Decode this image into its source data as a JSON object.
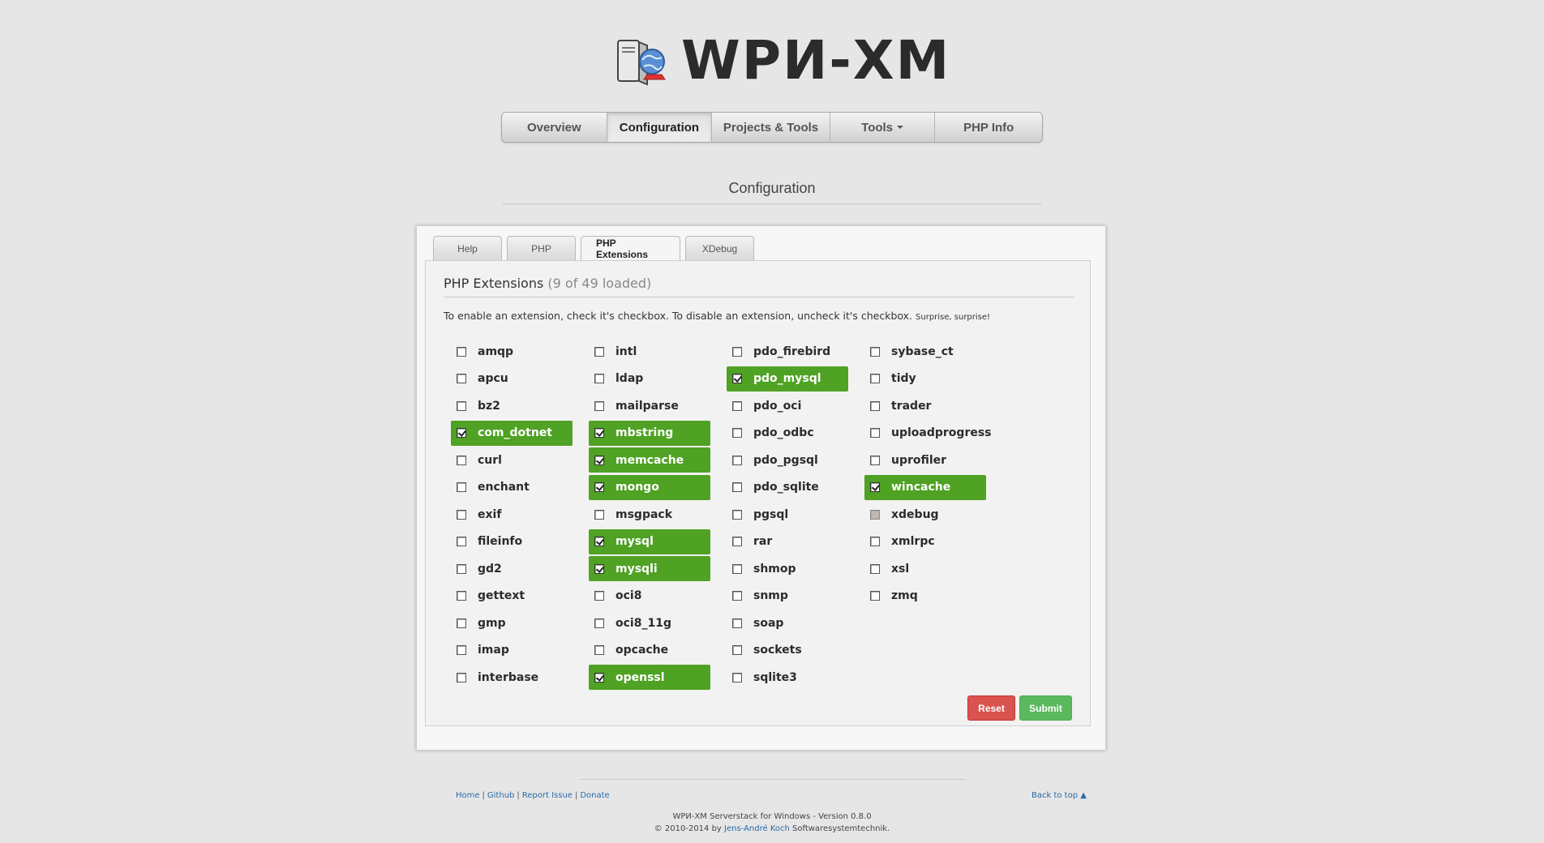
{
  "logo": {
    "text": "WPИ-XM",
    "icon": "server-globe-icon"
  },
  "nav": [
    {
      "label": "Overview",
      "active": false
    },
    {
      "label": "Configuration",
      "active": true
    },
    {
      "label": "Projects & Tools",
      "active": false
    },
    {
      "label": "Tools",
      "active": false,
      "dropdown": true
    },
    {
      "label": "PHP Info",
      "active": false
    }
  ],
  "page_heading": "Configuration",
  "tabs": [
    {
      "label": "Help",
      "active": false
    },
    {
      "label": "PHP",
      "active": false
    },
    {
      "label": "PHP Extensions",
      "active": true
    },
    {
      "label": "XDebug",
      "active": false
    }
  ],
  "extensions_panel": {
    "title": "PHP Extensions",
    "count_text": "(9 of 49 loaded)",
    "instructions": "To enable an extension, check it's checkbox. To disable an extension, uncheck it's checkbox.",
    "instructions_small": "Surprise, surprise!",
    "columns": [
      [
        {
          "name": "amqp",
          "checked": false
        },
        {
          "name": "apcu",
          "checked": false
        },
        {
          "name": "bz2",
          "checked": false
        },
        {
          "name": "com_dotnet",
          "checked": true
        },
        {
          "name": "curl",
          "checked": false
        },
        {
          "name": "enchant",
          "checked": false
        },
        {
          "name": "exif",
          "checked": false
        },
        {
          "name": "fileinfo",
          "checked": false
        },
        {
          "name": "gd2",
          "checked": false
        },
        {
          "name": "gettext",
          "checked": false
        },
        {
          "name": "gmp",
          "checked": false
        },
        {
          "name": "imap",
          "checked": false
        },
        {
          "name": "interbase",
          "checked": false
        }
      ],
      [
        {
          "name": "intl",
          "checked": false
        },
        {
          "name": "ldap",
          "checked": false
        },
        {
          "name": "mailparse",
          "checked": false
        },
        {
          "name": "mbstring",
          "checked": true
        },
        {
          "name": "memcache",
          "checked": true
        },
        {
          "name": "mongo",
          "checked": true
        },
        {
          "name": "msgpack",
          "checked": false
        },
        {
          "name": "mysql",
          "checked": true
        },
        {
          "name": "mysqli",
          "checked": true
        },
        {
          "name": "oci8",
          "checked": false
        },
        {
          "name": "oci8_11g",
          "checked": false
        },
        {
          "name": "opcache",
          "checked": false
        },
        {
          "name": "openssl",
          "checked": true
        }
      ],
      [
        {
          "name": "pdo_firebird",
          "checked": false
        },
        {
          "name": "pdo_mysql",
          "checked": true
        },
        {
          "name": "pdo_oci",
          "checked": false
        },
        {
          "name": "pdo_odbc",
          "checked": false
        },
        {
          "name": "pdo_pgsql",
          "checked": false
        },
        {
          "name": "pdo_sqlite",
          "checked": false
        },
        {
          "name": "pgsql",
          "checked": false
        },
        {
          "name": "rar",
          "checked": false
        },
        {
          "name": "shmop",
          "checked": false
        },
        {
          "name": "snmp",
          "checked": false
        },
        {
          "name": "soap",
          "checked": false
        },
        {
          "name": "sockets",
          "checked": false
        },
        {
          "name": "sqlite3",
          "checked": false
        }
      ],
      [
        {
          "name": "sybase_ct",
          "checked": false
        },
        {
          "name": "tidy",
          "checked": false
        },
        {
          "name": "trader",
          "checked": false
        },
        {
          "name": "uploadprogress",
          "checked": false
        },
        {
          "name": "uprofiler",
          "checked": false
        },
        {
          "name": "wincache",
          "checked": true
        },
        {
          "name": "xdebug",
          "checked": false,
          "disabled": true
        },
        {
          "name": "xmlrpc",
          "checked": false
        },
        {
          "name": "xsl",
          "checked": false
        },
        {
          "name": "zmq",
          "checked": false
        }
      ]
    ],
    "reset_label": "Reset",
    "submit_label": "Submit"
  },
  "footer": {
    "links": [
      "Home",
      "Github",
      "Report Issue",
      "Donate"
    ],
    "back_to_top": "Back to top ▲",
    "line1": "WPИ-XM Serverstack for Windows - Version 0.8.0",
    "line2_prefix": "© 2010-2014 by ",
    "line2_author": "Jens-André Koch",
    "line2_suffix": " Softwaresystemtechnik."
  },
  "colors": {
    "enabled_green": "#4fa223",
    "reset_red": "#d9534f",
    "submit_green": "#5cb85c",
    "link_blue": "#2a6aa7"
  }
}
